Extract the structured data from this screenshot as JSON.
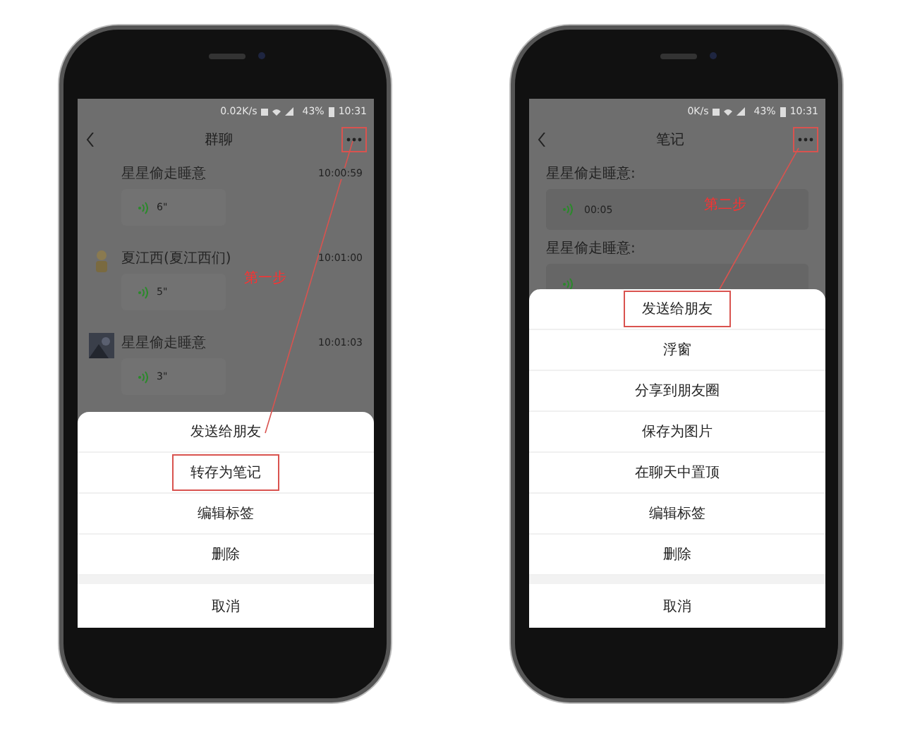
{
  "phones": [
    {
      "status": {
        "speed": "0.02K/s",
        "battery": "43%",
        "time": "10:31"
      },
      "title": "群聊",
      "kind": "chat",
      "messages": [
        {
          "sender": "星星偷走睡意",
          "time": "10:00:59",
          "duration": "6\"",
          "kind": "plain"
        },
        {
          "sender": "夏江西(夏江西们)",
          "time": "10:01:00",
          "duration": "5\"",
          "kind": "figure"
        },
        {
          "sender": "星星偷走睡意",
          "time": "10:01:03",
          "duration": "3\""
        }
      ],
      "step": "第一步",
      "sheet": {
        "items": [
          {
            "label": "发送给朋友",
            "marked": false
          },
          {
            "label": "转存为笔记",
            "marked": true
          },
          {
            "label": "编辑标签",
            "marked": false
          },
          {
            "label": "删除",
            "marked": false
          }
        ],
        "cancel": "取消"
      }
    },
    {
      "status": {
        "speed": "0K/s",
        "battery": "43%",
        "time": "10:31"
      },
      "title": "笔记",
      "kind": "note",
      "notes": [
        {
          "heading": "星星偷走睡意:",
          "duration": "00:05"
        },
        {
          "heading": "星星偷走睡意:"
        }
      ],
      "step": "第二步",
      "sheet": {
        "items": [
          {
            "label": "发送给朋友",
            "marked": true
          },
          {
            "label": "浮窗",
            "marked": false
          },
          {
            "label": "分享到朋友圈",
            "marked": false
          },
          {
            "label": "保存为图片",
            "marked": false
          },
          {
            "label": "在聊天中置顶",
            "marked": false
          },
          {
            "label": "编辑标签",
            "marked": false
          },
          {
            "label": "删除",
            "marked": false
          }
        ],
        "cancel": "取消"
      }
    }
  ]
}
